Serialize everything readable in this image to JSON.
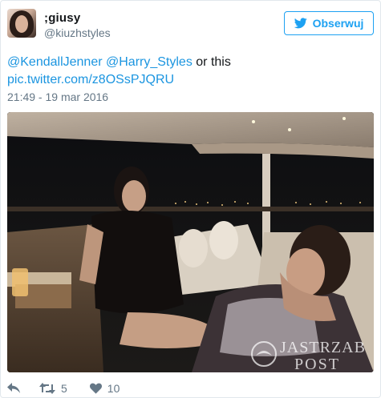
{
  "user": {
    "display_name": ";giusy",
    "screen_name": "@kiuzhstyles"
  },
  "follow_button": {
    "label": "Obserwuj",
    "icon": "twitter-bird-icon"
  },
  "tweet": {
    "mention_1": "@KendallJenner",
    "mention_2": "@Harry_Styles",
    "text_suffix": " or this",
    "link": "pic.twitter.com/z8OSsPJQRU",
    "timestamp": "21:49 - 19 mar 2016"
  },
  "photo": {
    "watermark_line_1": "JASTRZAB",
    "watermark_line_2": "POST"
  },
  "actions": {
    "reply_icon": "reply-icon",
    "retweet_icon": "retweet-icon",
    "retweet_count": "5",
    "like_icon": "heart-icon",
    "like_count": "10"
  },
  "colors": {
    "link": "#1b95e0",
    "follow": "#1da1f2",
    "muted": "#657786"
  }
}
